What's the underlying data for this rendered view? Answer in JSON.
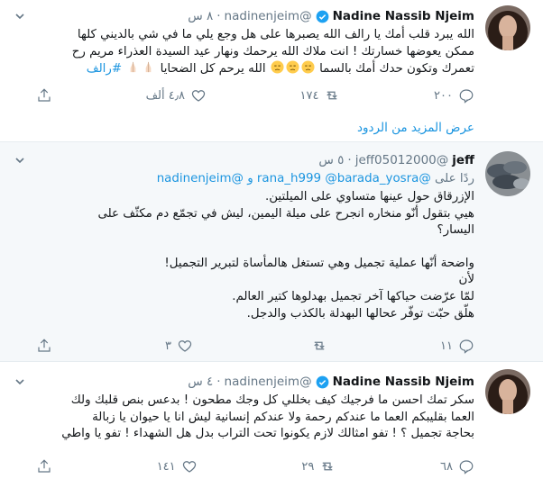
{
  "tweets": [
    {
      "name": "Nadine Nassib Njeim",
      "handle": "@nadinenjeim",
      "sep": "·",
      "time": "٨ س",
      "lines": [
        "الله يبرد قلب أمك يا رالف الله يصبرها على هل وجع يلي ما في شي بالديني كلها",
        "ممكن يعوضها خسارتك ! انت ملاك الله يرحمك ونهار عيد السيدة العذراء مريم رح",
        "تعمرك وتكون حدك أمك بالسما",
        "الله يرحم كل الضحايا",
        "#رالف"
      ],
      "actions": {
        "reply": "٢٠٠",
        "retweet": "١٧٤",
        "like": "٤٫٨ ألف"
      }
    },
    {
      "name": "jeff",
      "handle": "@jeff05012000",
      "sep": "·",
      "time": "٥ س",
      "reply_prefix": "ردًا على",
      "reply_users": "@rana_h999 @barada_yosra و @nadinenjeim",
      "lines": [
        "الإزرقاق حول عينها متساوي على الميلتين.",
        "هيي بتقول أنّو منخاره انجرح على ميلة اليمين، ليش في تجمّع دم مكثّف على",
        "اليسار؟",
        "واضحة أنّها عملية تجميل وهي تستغل هالمأساة لتبرير التجميل!",
        "لأن",
        "لمّا عرّضت حياكها آخر تجميل بهدلوها كتير العالم.",
        "هلّق حبّت توفّر عحالها البهدلة بالكذب والدجل."
      ],
      "actions": {
        "reply": "١١",
        "retweet": "",
        "like": "٣"
      }
    },
    {
      "name": "Nadine Nassib Njeim",
      "handle": "@nadinenjeim",
      "sep": "·",
      "time": "٤ س",
      "lines": [
        "سكر تمك احسن ما فرجيك كيف بخللي كل وجك مطحون ! بدعس بنص قلبك ولك",
        "العما بقليبكم العما ما عندكم رحمة ولا عندكم إنسانية ليش انا يا حيوان يا زبالة",
        "بحاجة تجميل ؟ ! تفو امثالك لازم يكونوا تحت التراب بدل هل الشهداء ! تفو يا واطي"
      ],
      "actions": {
        "reply": "٦٨",
        "retweet": "٢٩",
        "like": "١٤١"
      }
    }
  ],
  "show_more_replies": "عرض المزيد من الردود",
  "colors": {
    "link": "#1b95e0",
    "muted": "#657786",
    "verified": "#1da1f2",
    "highlight_bg": "#f5f8fa"
  }
}
